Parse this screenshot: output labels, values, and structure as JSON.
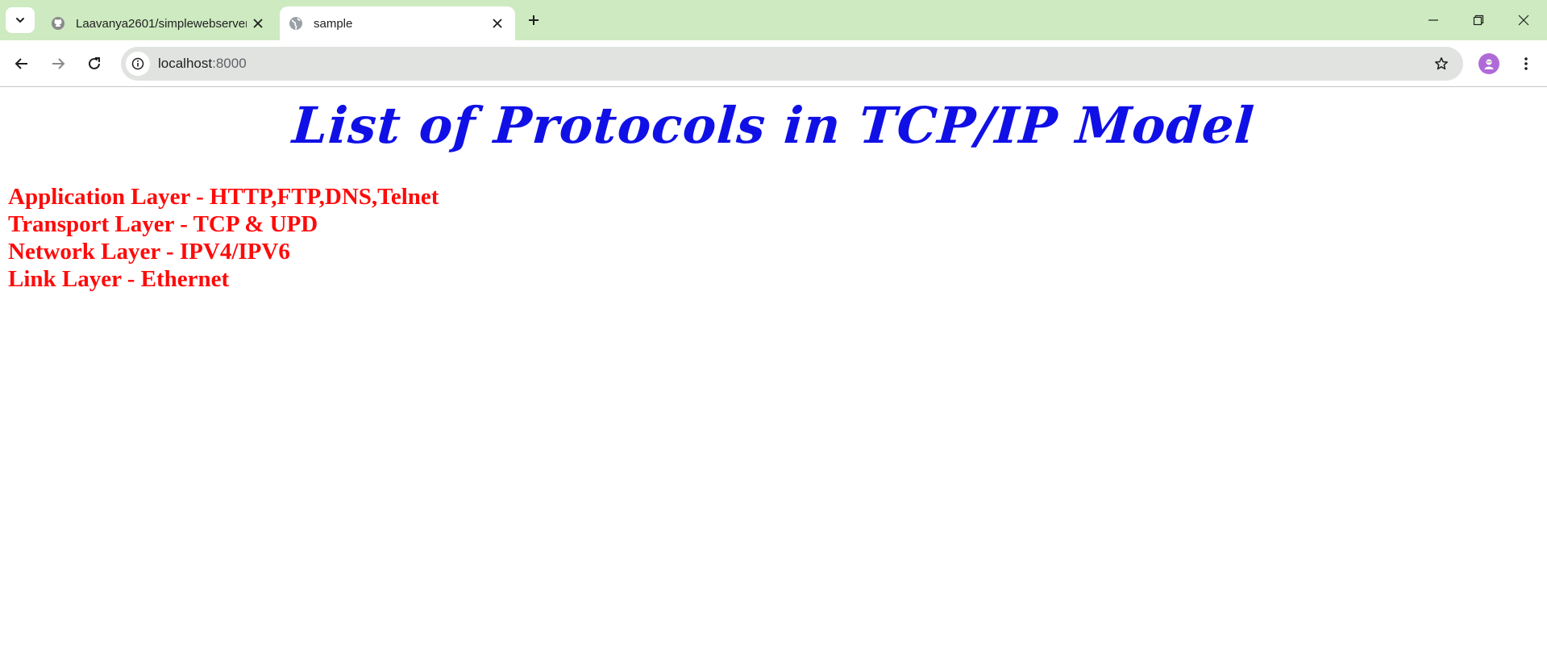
{
  "browser": {
    "tabs": [
      {
        "title": "Laavanya2601/simplewebserver",
        "favicon": "github-icon",
        "active": false
      },
      {
        "title": "sample",
        "favicon": "globe-icon",
        "active": true
      }
    ],
    "address": {
      "host": "localhost",
      "port": ":8000"
    },
    "avatar_icon": "profile-avatar-icon"
  },
  "page": {
    "heading": "List of Protocols in TCP/IP Model",
    "layers": [
      "Application Layer - HTTP,FTP,DNS,Telnet",
      "Transport Layer - TCP & UPD",
      "Network Layer - IPV4/IPV6",
      "Link Layer - Ethernet"
    ]
  },
  "colors": {
    "tabstrip_bg": "#cdeac0",
    "heading": "#1010e6",
    "layer_text": "#ff0a0a",
    "avatar": "#b06ad8"
  }
}
